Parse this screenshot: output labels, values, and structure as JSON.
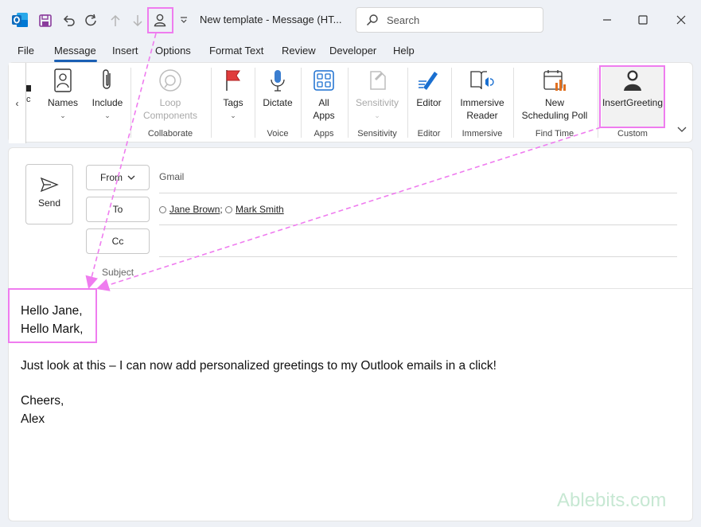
{
  "window": {
    "title": "New template  -  Message (HT...",
    "search_placeholder": "Search"
  },
  "menu": {
    "items": [
      "File",
      "Message",
      "Insert",
      "Options",
      "Format Text",
      "Review",
      "Developer",
      "Help"
    ],
    "active": "Message"
  },
  "ribbon": {
    "names": "Names",
    "include": "Include",
    "loop_components_1": "Loop",
    "loop_components_2": "Components",
    "collaborate": "Collaborate",
    "tags": "Tags",
    "dictate": "Dictate",
    "voice": "Voice",
    "all_apps_1": "All",
    "all_apps_2": "Apps",
    "apps": "Apps",
    "sensitivity_btn": "Sensitivity",
    "sensitivity_group": "Sensitivity",
    "editor_btn": "Editor",
    "editor_group": "Editor",
    "immersive_reader_1": "Immersive",
    "immersive_reader_2": "Reader",
    "immersive_group": "Immersive",
    "scheduling_1": "New",
    "scheduling_2": "Scheduling Poll",
    "find_time": "Find Time",
    "insert_greeting": "InsertGreeting",
    "custom": "Custom",
    "cut_label": "c"
  },
  "compose": {
    "send": "Send",
    "from_label": "From",
    "from_value": "Gmail",
    "to_label": "To",
    "recipients": [
      "Jane Brown",
      "Mark Smith"
    ],
    "cc_label": "Cc",
    "subject_placeholder": "Subject"
  },
  "body": {
    "greeting_1": "Hello Jane,",
    "greeting_2": "Hello Mark,",
    "line": "Just look at this – I can now add personalized greetings to my Outlook emails in a click!",
    "closing": "Cheers,",
    "signature": "Alex"
  },
  "watermark": "Ablebits.com",
  "colors": {
    "highlight": "#ef7cef",
    "accent": "#1a5fb4",
    "outlook_blue": "#0f6cbd"
  }
}
